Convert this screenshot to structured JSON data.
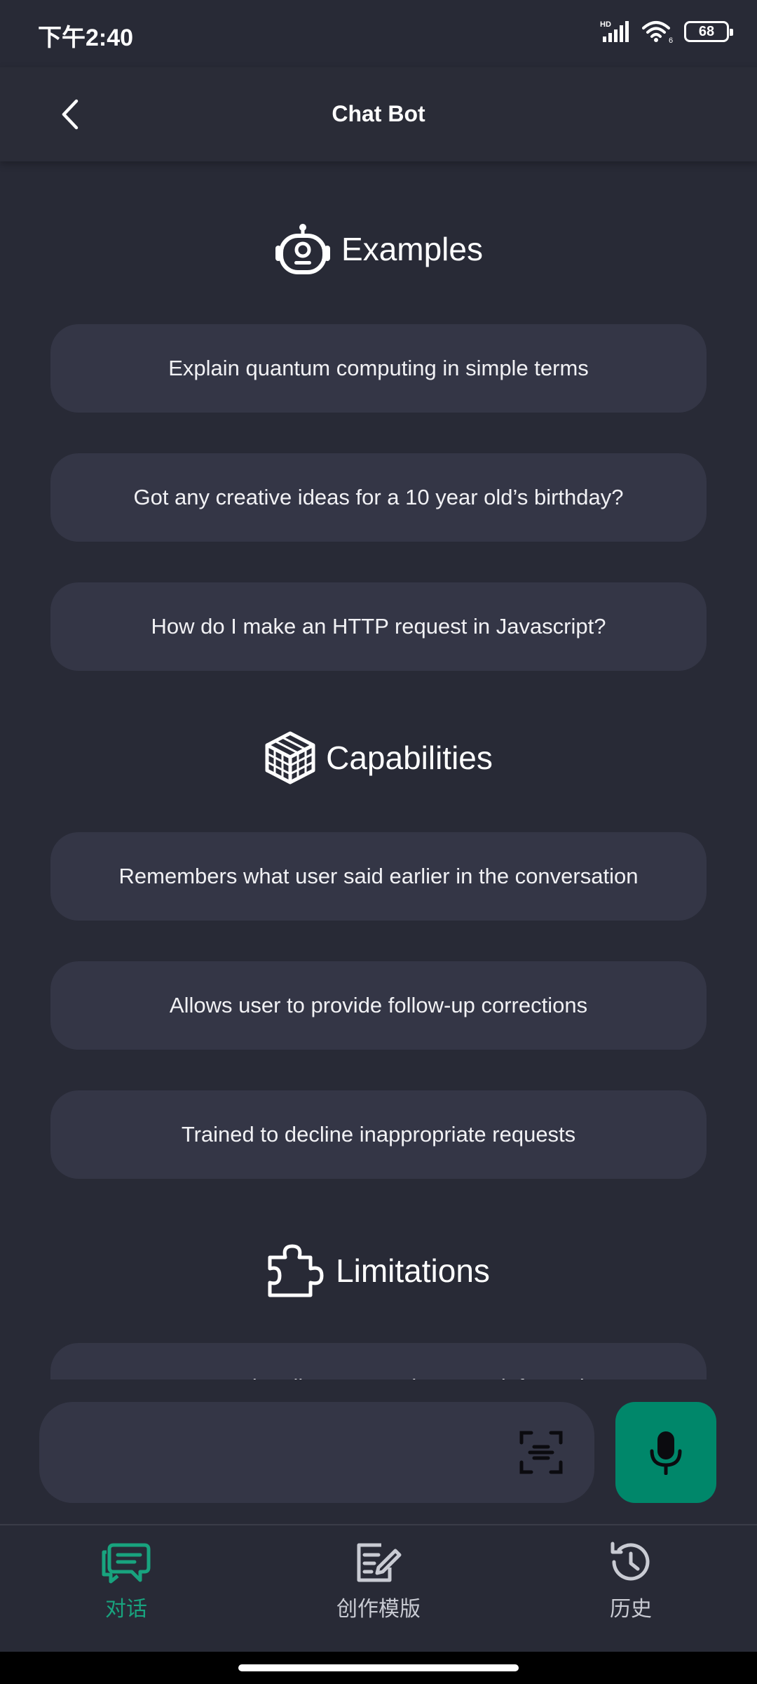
{
  "status_bar": {
    "time": "下午2:40",
    "battery": "68",
    "signal_badge": "HD",
    "wifi_badge": "6"
  },
  "app_bar": {
    "title": "Chat Bot"
  },
  "sections": [
    {
      "title": "Examples",
      "icon": "robot-icon",
      "items": [
        "Explain quantum computing in simple terms",
        "Got any creative ideas for a 10 year old’s birthday?",
        "How do I make an HTTP request in Javascript?"
      ]
    },
    {
      "title": "Capabilities",
      "icon": "cube-icon",
      "items": [
        "Remembers what user said earlier in the conversation",
        "Allows user to provide follow-up corrections",
        "Trained to decline inappropriate requests"
      ]
    },
    {
      "title": "Limitations",
      "icon": "puzzle-icon",
      "items": [
        "May occasionally generate incorrect information"
      ]
    }
  ],
  "input_bar": {
    "value": "",
    "scan_icon": "scan-text-icon",
    "mic_icon": "microphone-icon"
  },
  "bottom_nav": [
    {
      "label": "对话",
      "icon": "chat-icon",
      "active": true
    },
    {
      "label": "创作模版",
      "icon": "edit-document-icon",
      "active": false
    },
    {
      "label": "历史",
      "icon": "history-icon",
      "active": false
    }
  ],
  "colors": {
    "background": "#282a36",
    "card": "#343646",
    "accent": "#00876a",
    "active_nav": "#18a37e"
  }
}
